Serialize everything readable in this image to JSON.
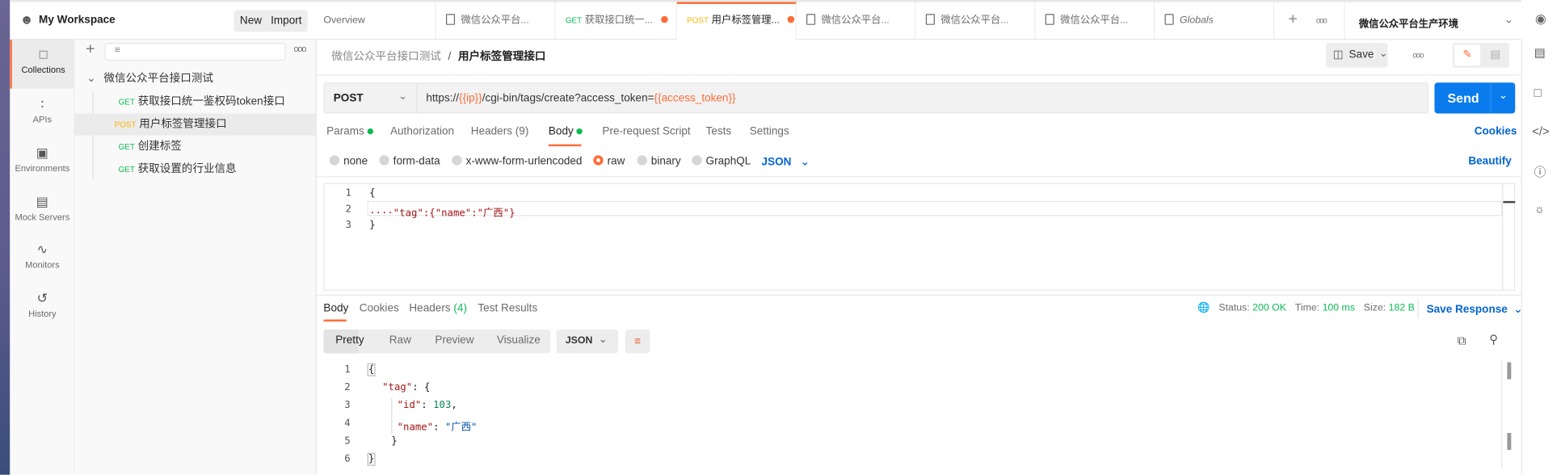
{
  "workspace": {
    "title": "My Workspace",
    "new_label": "New",
    "import_label": "Import"
  },
  "nav": [
    {
      "label": "Collections",
      "icon": "collection-icon"
    },
    {
      "label": "APIs",
      "icon": "apis-icon"
    },
    {
      "label": "Environments",
      "icon": "environment-icon"
    },
    {
      "label": "Mock Servers",
      "icon": "mock-server-icon"
    },
    {
      "label": "Monitors",
      "icon": "monitor-icon"
    },
    {
      "label": "History",
      "icon": "history-icon"
    }
  ],
  "sidebar": {
    "folder": "微信公众平台接口测试",
    "items": [
      {
        "method": "GET",
        "name": "获取接口统一鉴权码token接口"
      },
      {
        "method": "POST",
        "name": "用户标签管理接口",
        "selected": true
      },
      {
        "method": "GET",
        "name": "创建标签"
      },
      {
        "method": "GET",
        "name": "获取设置的行业信息"
      }
    ]
  },
  "tabs": [
    {
      "label": "Overview"
    },
    {
      "label": "微信公众平台..."
    },
    {
      "method": "GET",
      "label": "获取接口统一...",
      "unsaved": true
    },
    {
      "method": "POST",
      "label": "用户标签管理...",
      "unsaved": true,
      "active": true
    },
    {
      "label": "微信公众平台..."
    },
    {
      "label": "微信公众平台..."
    },
    {
      "label": "微信公众平台..."
    },
    {
      "label": "Globals"
    }
  ],
  "environment": "微信公众平台生产环境",
  "breadcrumb": {
    "parent": "微信公众平台接口测试",
    "sep": "/",
    "current": "用户标签管理接口"
  },
  "save_label": "Save",
  "request": {
    "method": "POST",
    "url_prefix": "https://",
    "var_ip": "{{ip}}",
    "url_mid": "/cgi-bin/tags/create?access_token=",
    "var_token": "{{access_token}}",
    "send_label": "Send"
  },
  "req_tabs": {
    "params": "Params",
    "authorization": "Authorization",
    "headers": "Headers",
    "headers_count": "(9)",
    "body": "Body",
    "prerequest": "Pre-request Script",
    "tests": "Tests",
    "settings": "Settings",
    "cookies": "Cookies"
  },
  "body_types": {
    "none": "none",
    "form_data": "form-data",
    "urlencoded": "x-www-form-urlencoded",
    "raw": "raw",
    "binary": "binary",
    "graphql": "GraphQL",
    "format": "JSON",
    "beautify": "Beautify",
    "selected": "raw"
  },
  "request_body": {
    "lines": [
      "{",
      "····\"tag\":{\"name\":\"广西\"}",
      "}"
    ]
  },
  "response": {
    "tabs": {
      "body": "Body",
      "cookies": "Cookies",
      "headers": "Headers",
      "headers_count": "(4)",
      "tests": "Test Results"
    },
    "status_label": "Status:",
    "status": "200 OK",
    "time_label": "Time:",
    "time": "100 ms",
    "size_label": "Size:",
    "size": "182 B",
    "save_response": "Save Response",
    "views": [
      "Pretty",
      "Raw",
      "Preview",
      "Visualize"
    ],
    "format": "JSON",
    "id": "103",
    "name": "广西"
  },
  "colors": {
    "accent": "#ff6c37",
    "send": "#097bed",
    "link": "#0265d2",
    "ok": "#0cbb52"
  }
}
